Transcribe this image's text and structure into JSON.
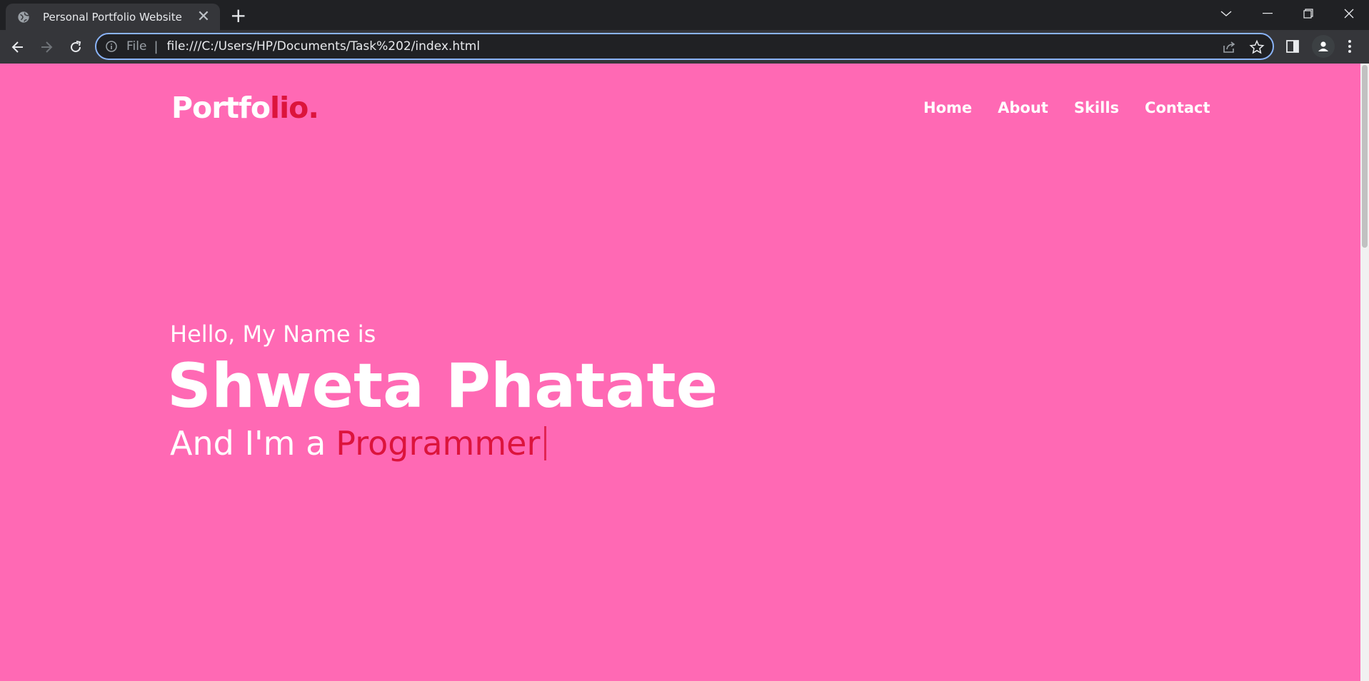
{
  "browser": {
    "tab_title": "Personal Portfolio Website",
    "close_glyph": "✕",
    "new_tab_glyph": "+",
    "omnibox": {
      "scheme_label": "File",
      "separator": "|",
      "url": "file:///C:/Users/HP/Documents/Task%202/index.html"
    },
    "icons": [
      "globe-icon",
      "close-icon",
      "plus-icon",
      "chevron-down-icon",
      "minimize-icon",
      "restore-icon",
      "window-close-icon",
      "back-icon",
      "forward-icon",
      "reload-icon",
      "info-icon",
      "share-icon",
      "star-icon",
      "side-panel-icon",
      "profile-icon",
      "more-icon"
    ],
    "accent_color": "#8ab4f8"
  },
  "site": {
    "logo_main": "Portfo",
    "logo_accent": "lio.",
    "nav": [
      {
        "label": "Home"
      },
      {
        "label": "About"
      },
      {
        "label": "Skills"
      },
      {
        "label": "Contact"
      }
    ],
    "hero": {
      "greeting": "Hello, My Name is",
      "name": "Shweta Phatate",
      "role_prefix": "And I'm a",
      "role_typed": "Programmer"
    },
    "colors": {
      "background": "#ff69b4",
      "accent": "#dc143c",
      "text": "#ffffff"
    }
  }
}
